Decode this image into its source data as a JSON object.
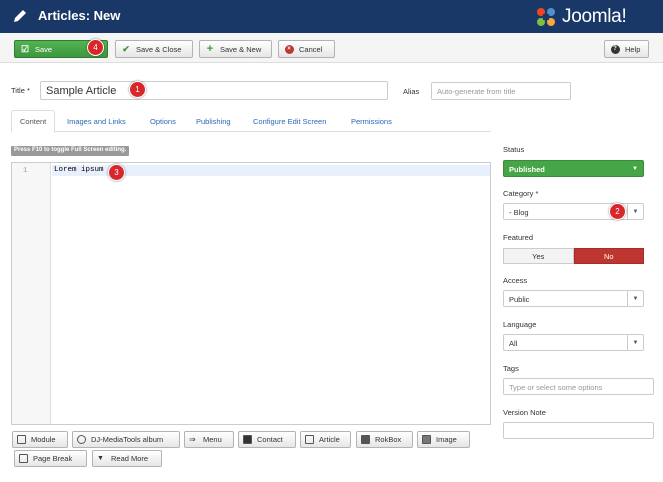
{
  "header": {
    "title": "Articles: New",
    "logo_text": "Joomla!"
  },
  "toolbar": {
    "save": "Save",
    "save_close": "Save & Close",
    "save_new": "Save & New",
    "cancel": "Cancel",
    "help": "Help"
  },
  "form": {
    "title_label": "Title *",
    "title_value": "Sample Article",
    "alias_label": "Alias",
    "alias_placeholder": "Auto-generate from title"
  },
  "tabs": [
    "Content",
    "Images and Links",
    "Options",
    "Publishing",
    "Configure Edit Screen",
    "Permissions"
  ],
  "editor": {
    "hint": "Press F10 to toggle Full Screen editing.",
    "line_number": "1",
    "text": "Lorem ipsum"
  },
  "editor_buttons": [
    "Module",
    "DJ-MediaTools album",
    "Menu",
    "Contact",
    "Article",
    "RokBox",
    "Image",
    "Page Break",
    "Read More"
  ],
  "sidebar": {
    "status_label": "Status",
    "status_value": "Published",
    "category_label": "Category *",
    "category_value": "- Blog",
    "featured_label": "Featured",
    "featured_yes": "Yes",
    "featured_no": "No",
    "access_label": "Access",
    "access_value": "Public",
    "language_label": "Language",
    "language_value": "All",
    "tags_label": "Tags",
    "tags_placeholder": "Type or select some options",
    "version_note_label": "Version Note",
    "version_note_value": ""
  },
  "badges": [
    "1",
    "2",
    "3",
    "4"
  ],
  "colors": {
    "header": "#1a3867",
    "save": "#46a546",
    "danger": "#bd362f",
    "badge": "#d9262b",
    "link": "#2a69b8"
  }
}
